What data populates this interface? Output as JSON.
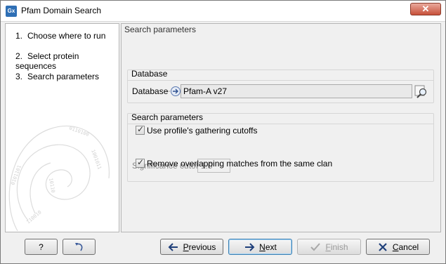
{
  "window": {
    "title": "Pfam Domain Search",
    "app_icon_text": "Gx",
    "close_glyph": "✕"
  },
  "steps": [
    {
      "num": "1.",
      "label": "Choose where to run"
    },
    {
      "num": "2.",
      "label": "Select protein sequences"
    },
    {
      "num": "3.",
      "label": "Search parameters"
    }
  ],
  "content": {
    "heading": "Search parameters",
    "database_group": {
      "title": "Database",
      "field_label": "Database",
      "value": "Pfam-A v27"
    },
    "search_group": {
      "title": "Search parameters",
      "gathering_cutoffs_label": "Use profile's gathering cutoffs",
      "gathering_cutoffs_checked": true,
      "significance_label": "Significance cutoff",
      "significance_value": "1.0",
      "remove_overlap_label": "Remove overlapping matches from the same clan",
      "remove_overlap_checked": true
    }
  },
  "buttons": {
    "help": "?",
    "previous_prefix": "",
    "previous_underlined": "P",
    "previous_rest": "revious",
    "next_underlined": "N",
    "next_rest": "ext",
    "finish_underlined": "F",
    "finish_rest": "inish",
    "cancel_underlined": "C",
    "cancel_rest": "ancel"
  },
  "colors": {
    "accent": "#2f6fb5",
    "close": "#c7503a",
    "default_button_border": "#3c7fb1"
  },
  "icons": {
    "app": "gx-logo-icon",
    "close": "close-icon",
    "database_arrow": "arrow-right-icon",
    "browse": "browse-search-icon",
    "reset": "undo-icon",
    "previous": "arrow-left-icon",
    "next": "arrow-right-icon",
    "finish": "check-icon",
    "cancel": "x-icon"
  }
}
